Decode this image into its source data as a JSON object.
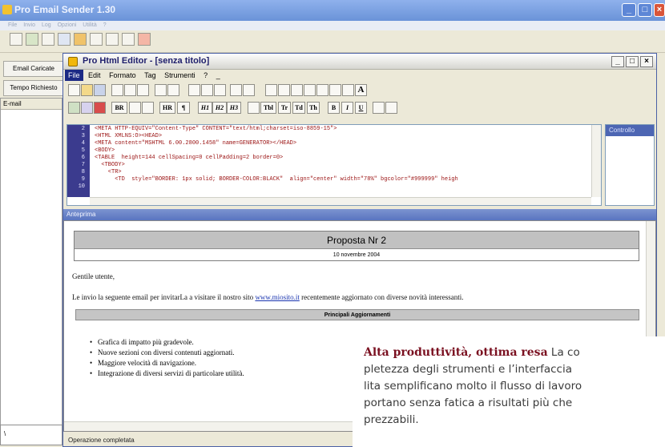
{
  "back_window": {
    "title": "Pro Email Sender 1.30",
    "menu": "File Invio Log Opzioni Utilità ?",
    "row1_label": "Email Caricate",
    "row2_label": "Tempo Richiesto",
    "list_header": "E-mail",
    "bottom_value": "\\"
  },
  "editor": {
    "title": "Pro Html Editor - [senza titolo]",
    "menu": [
      "File",
      "Edit",
      "Formato",
      "Tag",
      "Strumenti",
      "?",
      "_"
    ],
    "tag_buttons": [
      "BR",
      "HR",
      "¶",
      "H1",
      "H2",
      "H3",
      "Tbl",
      "Tr",
      "Td",
      "Th",
      "B",
      "I",
      "U",
      "A"
    ],
    "code_lines": [
      {
        "n": "2",
        "text": "<META HTTP-EQUIV=\"Content-Type\" CONTENT=\"text/html;charset=iso-8859-15\">"
      },
      {
        "n": "3",
        "text": "<HTML XMLNS:O><HEAD>"
      },
      {
        "n": "4",
        "text": "<META content=\"MSHTML 6.00.2800.1458\" name=GENERATOR></HEAD>"
      },
      {
        "n": "5",
        "text": "<BODY>"
      },
      {
        "n": "6",
        "text": "<TABLE  height=144 cellSpacing=0 cellPadding=2 border=0>"
      },
      {
        "n": "7",
        "text": "  <TBODY>"
      },
      {
        "n": "8",
        "text": "    <TR>"
      },
      {
        "n": "9",
        "text": "      <TD  style=\"BORDER: 1px solid; BORDER-COLOR:BLACK\"  align=\"center\" width=\"78%\" bgcolor=\"#999999\" heigh"
      },
      {
        "n": "10",
        "text": ""
      }
    ],
    "controls_header": "Controllo",
    "preview_header": "Anteprima",
    "preview": {
      "heading": "Proposta Nr 2",
      "date": "10 novembre 2004",
      "greeting": "Gentile utente,",
      "body_before": "Le invio la seguente email per invitarLa a visitare il nostro sito ",
      "link": "www.miosito.it",
      "body_after": " recentemente aggiornato con diverse novità interessanti.",
      "section_title": "Principali Aggiornamenti",
      "bullets": [
        "Grafica di impatto più gradevole.",
        "Nuove sezioni con diversi contenuti aggiornati.",
        "Maggiore velocità di navigazione.",
        "Integrazione di diversi servizi di particolare utilità."
      ]
    },
    "status": "Operazione completata"
  },
  "caption": {
    "bold": "Alta produttività, ottima resa",
    "lines": [
      " La co",
      "pletezza degli strumenti e l’interfaccia",
      "lita semplificano molto il flusso di lavoro",
      "portano senza fatica a risultati più che",
      "prezzabili."
    ]
  },
  "colors": {
    "caption_bold": "#7a1020",
    "code_text": "#9a1010",
    "gutter": "#3b3b8e"
  }
}
